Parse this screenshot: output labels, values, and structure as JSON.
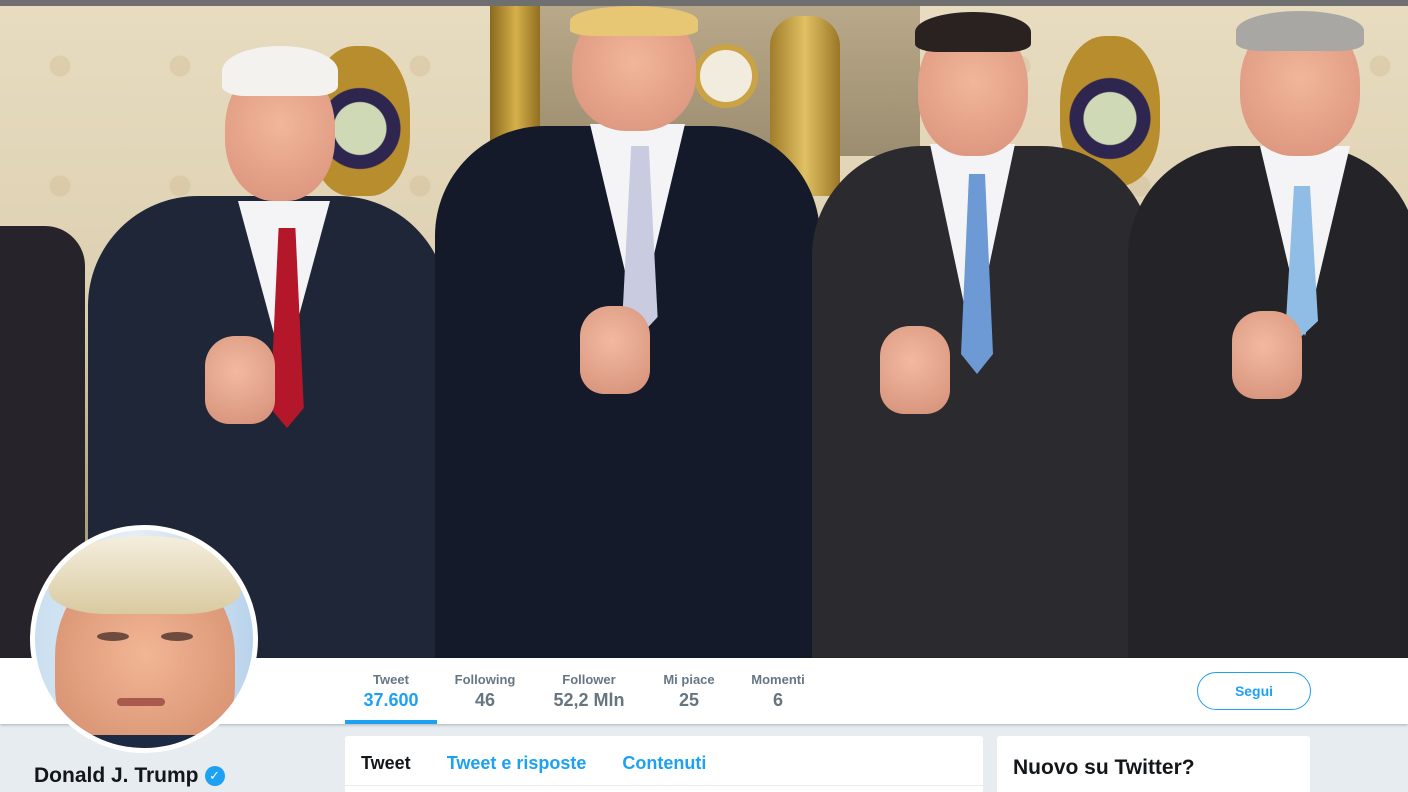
{
  "profile": {
    "display_name": "Donald J. Trump",
    "verified_icon": "verified-badge-icon"
  },
  "stats": [
    {
      "label": "Tweet",
      "value": "37.600",
      "active": true
    },
    {
      "label": "Following",
      "value": "46",
      "active": false
    },
    {
      "label": "Follower",
      "value": "52,2 Mln",
      "active": false
    },
    {
      "label": "Mi piace",
      "value": "25",
      "active": false
    },
    {
      "label": "Momenti",
      "value": "6",
      "active": false
    }
  ],
  "follow_button": {
    "label": "Segui"
  },
  "timeline_tabs": [
    {
      "label": "Tweet",
      "active": true
    },
    {
      "label": "Tweet e risposte",
      "active": false
    },
    {
      "label": "Contenuti",
      "active": false
    }
  ],
  "signup_card": {
    "title": "Nuovo su Twitter?"
  },
  "colors": {
    "accent": "#1da1f2",
    "background": "#e6ecf0",
    "text_dark": "#14171a",
    "text_muted": "#657786"
  }
}
